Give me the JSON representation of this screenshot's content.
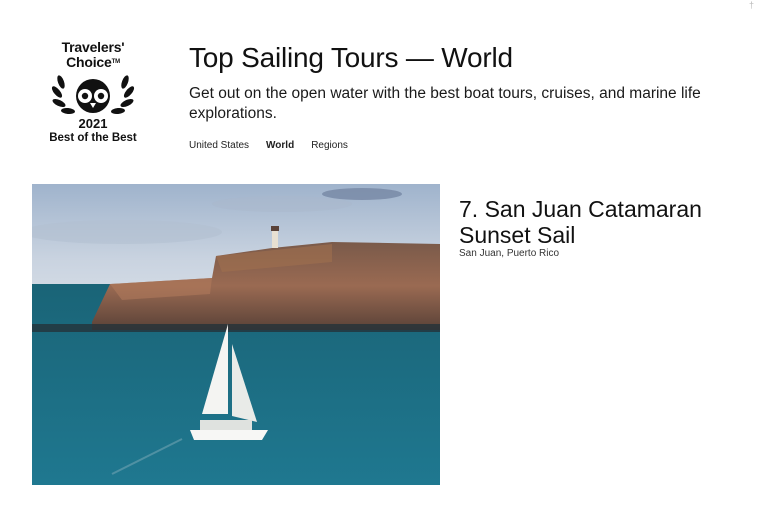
{
  "badge": {
    "line1": "Travelers'",
    "line2": "Choice",
    "trademark": "TM",
    "year": "2021",
    "subtitle": "Best of the Best",
    "icon": "owl-laurel-icon"
  },
  "header": {
    "title": "Top Sailing Tours — World",
    "description": "Get out on the open water with the best boat tours, cruises, and marine life explorations."
  },
  "tabs": [
    {
      "label": "United States",
      "active": false
    },
    {
      "label": "World",
      "active": true
    },
    {
      "label": "Regions",
      "active": false
    }
  ],
  "listing": {
    "rank_title": "7. San Juan Catamaran Sunset Sail",
    "location": "San Juan, Puerto Rico",
    "image": "catamaran-sailing-fort-photo"
  },
  "colors": {
    "sea": "#1f6f86",
    "sky": "#c9d6e4",
    "cliff": "#8a5a45",
    "text": "#111111"
  }
}
